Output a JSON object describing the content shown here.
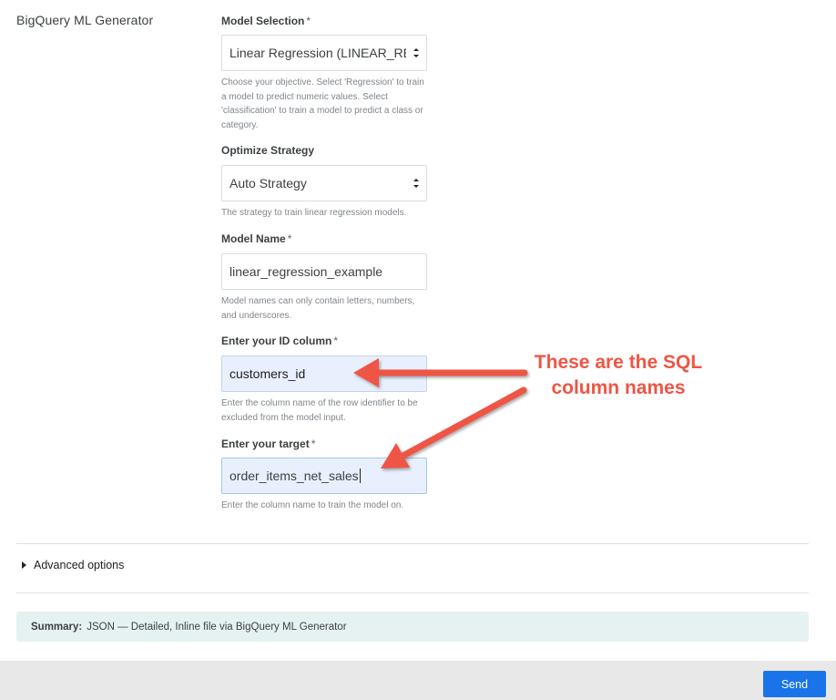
{
  "sidebar": {
    "title": "BigQuery ML Generator"
  },
  "form": {
    "model_selection": {
      "label": "Model Selection",
      "required_mark": "*",
      "value": "Linear Regression (LINEAR_RE",
      "hint": "Choose your objective. Select 'Regression' to train a model to predict numeric values. Select 'classification' to train a model to predict a class or category."
    },
    "optimize_strategy": {
      "label": "Optimize Strategy",
      "value": "Auto Strategy",
      "hint": "The strategy to train linear regression models."
    },
    "model_name": {
      "label": "Model Name",
      "required_mark": "*",
      "value": "linear_regression_example",
      "hint": "Model names can only contain letters, numbers, and underscores."
    },
    "id_column": {
      "label": "Enter your ID column",
      "required_mark": "*",
      "value": "customers_id",
      "hint": "Enter the column name of the row identifier to be excluded from the model input."
    },
    "target": {
      "label": "Enter your target",
      "required_mark": "*",
      "value": "order_items_net_sales",
      "hint": "Enter the column name to train the model on."
    }
  },
  "advanced": {
    "label": "Advanced options"
  },
  "summary": {
    "label": "Summary:",
    "text": "JSON — Detailed, Inline file via BigQuery ML Generator"
  },
  "footer": {
    "send_label": "Send"
  },
  "annotation": {
    "line1": "These are the SQL",
    "line2": "column names",
    "color": "#ef5545"
  },
  "colors": {
    "primary": "#1a73e8",
    "autofill": "#e8f0fe",
    "summary_bg": "#e6f2f1"
  }
}
